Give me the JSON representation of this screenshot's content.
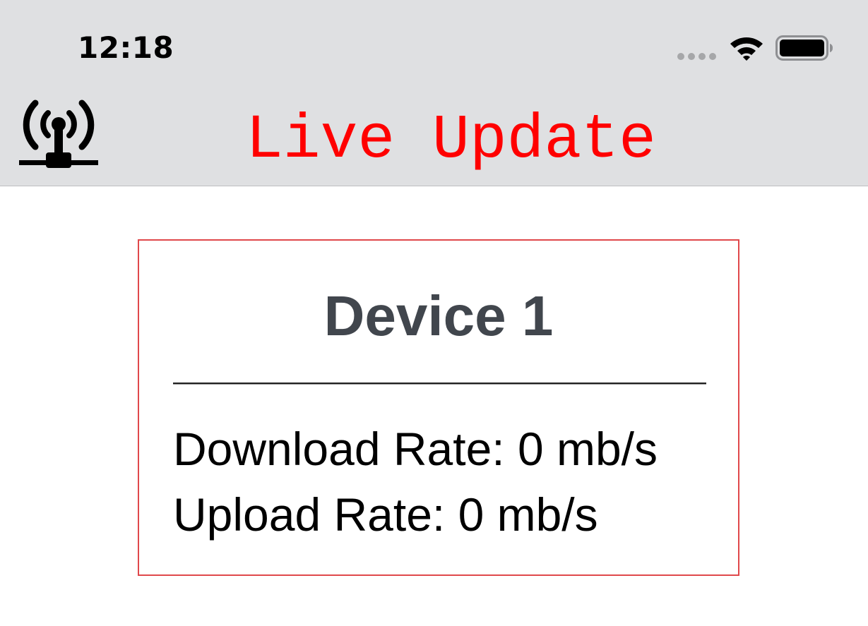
{
  "status_bar": {
    "time": "12:18",
    "signal_icon": "cellular-signal-dots-icon",
    "wifi_icon": "wifi-icon",
    "battery_icon": "battery-icon"
  },
  "nav_bar": {
    "logo_icon": "broadcast-antenna-icon",
    "title": "Live Update",
    "title_color": "#ff0000",
    "background_color": "#dfe0e2"
  },
  "device_card": {
    "border_color": "#e0484b",
    "name": "Device 1",
    "download_rate": "Download Rate: 0 mb/s",
    "upload_rate": "Upload Rate: 0 mb/s"
  }
}
